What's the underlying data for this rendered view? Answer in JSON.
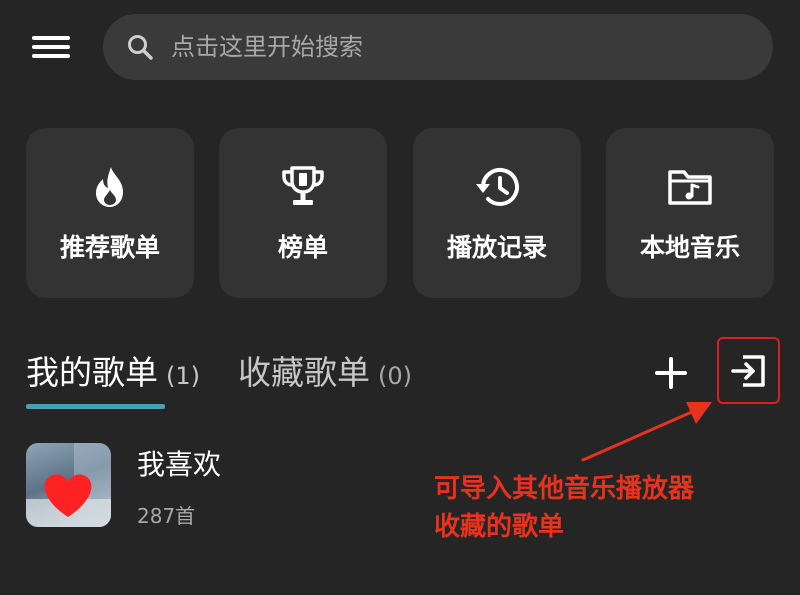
{
  "search": {
    "placeholder": "点击这里开始搜索"
  },
  "quick_entries": [
    {
      "label": "推荐歌单",
      "icon": "flame-icon"
    },
    {
      "label": "榜单",
      "icon": "trophy-icon"
    },
    {
      "label": "播放记录",
      "icon": "history-icon"
    },
    {
      "label": "本地音乐",
      "icon": "music-folder-icon"
    }
  ],
  "tabs": [
    {
      "label": "我的歌单",
      "count": "(1)",
      "active": true
    },
    {
      "label": "收藏歌单",
      "count": "(0)",
      "active": false
    }
  ],
  "actions": {
    "add_icon": "plus-icon",
    "import_icon": "import-icon"
  },
  "playlists": [
    {
      "title": "我喜欢",
      "count": "287首"
    }
  ],
  "annotation": {
    "line1": "可导入其他音乐播放器",
    "line2": "收藏的歌单",
    "color": "#e8321e"
  },
  "colors": {
    "background": "#252525",
    "card": "#333333",
    "search_bar": "#3a3a3a",
    "accent": "#4aa0b6",
    "highlight_box": "#d82020"
  }
}
